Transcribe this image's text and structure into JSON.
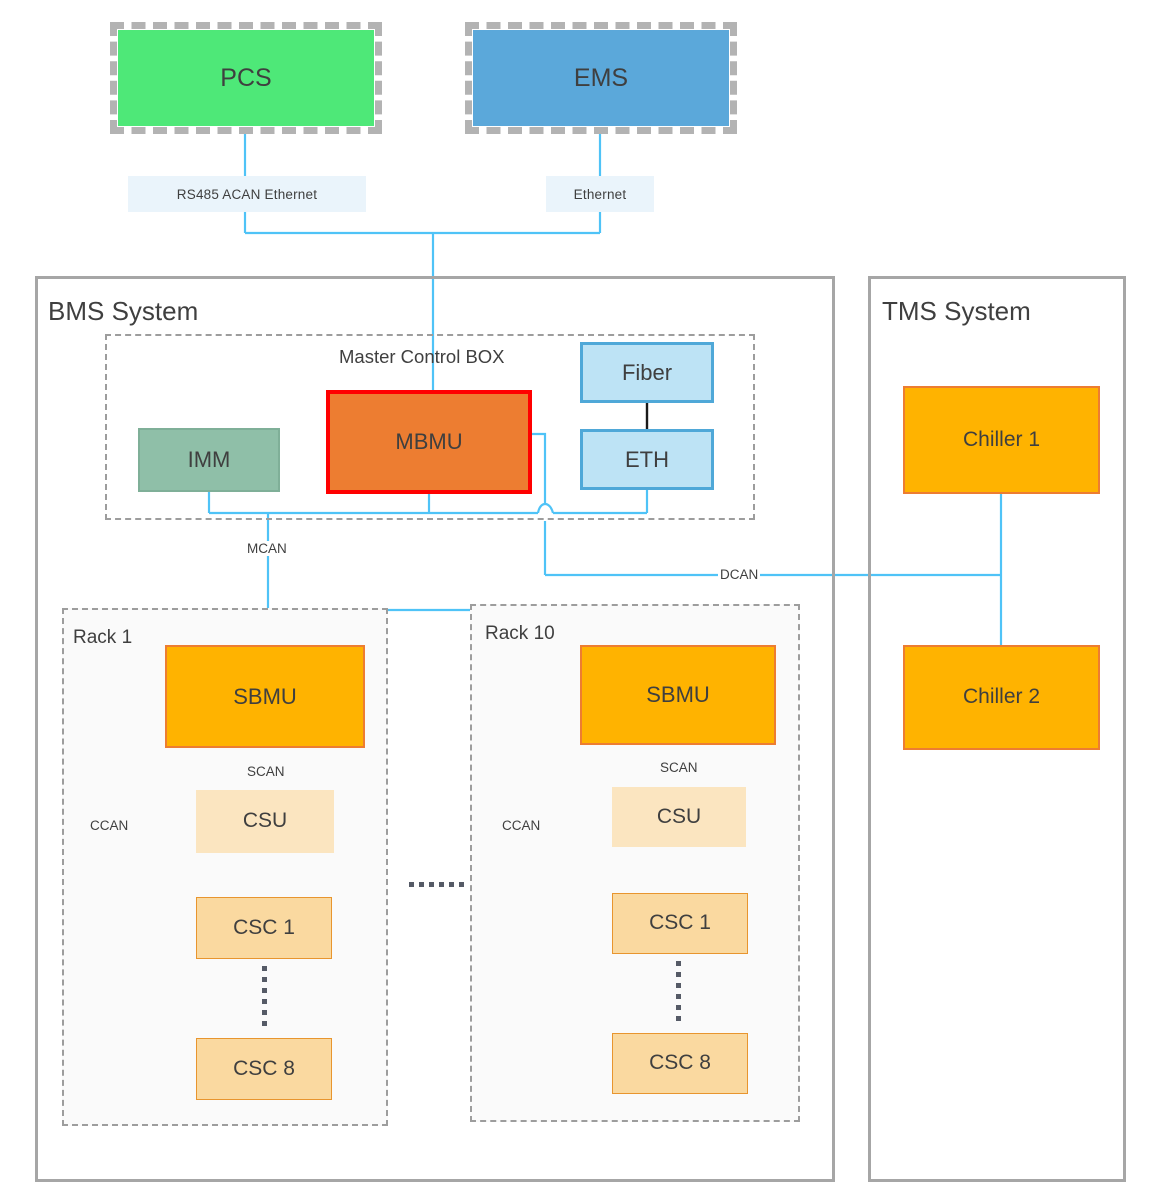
{
  "diagram": {
    "external_systems": [
      {
        "id": "pcs",
        "label": "PCS",
        "color": "#4EE878"
      },
      {
        "id": "ems",
        "label": "EMS",
        "color": "#5BA8DA"
      }
    ],
    "protocol_chips": [
      {
        "id": "pcs-protocols",
        "label": "RS485  ACAN   Ethernet"
      },
      {
        "id": "ems-protocols",
        "label": "Ethernet"
      }
    ],
    "panels": [
      {
        "id": "bms",
        "title": "BMS System"
      },
      {
        "id": "tms",
        "title": "TMS System"
      }
    ],
    "master_control_box": {
      "title": "Master Control BOX",
      "nodes": [
        {
          "id": "imm",
          "label": "IMM",
          "color": "#8FBFA8"
        },
        {
          "id": "mbmu",
          "label": "MBMU",
          "color": "#ED7D31",
          "border": "#FF0000"
        },
        {
          "id": "fiber",
          "label": "Fiber",
          "color": "#BDE3F5"
        },
        {
          "id": "eth",
          "label": "ETH",
          "color": "#BDE3F5"
        }
      ]
    },
    "buses": [
      {
        "id": "mcan",
        "label": "MCAN"
      },
      {
        "id": "dcan",
        "label": "DCAN"
      }
    ],
    "racks": [
      {
        "id": "rack-1",
        "title": "Rack 1",
        "sbmu": "SBMU",
        "scan_label": "SCAN",
        "ccan_label": "CCAN",
        "csu": "CSU",
        "csc_first": "CSC 1",
        "csc_last": "CSC 8"
      },
      {
        "id": "rack-10",
        "title": "Rack 10",
        "sbmu": "SBMU",
        "scan_label": "SCAN",
        "ccan_label": "CCAN",
        "csu": "CSU",
        "csc_first": "CSC 1",
        "csc_last": "CSC 8"
      }
    ],
    "tms_nodes": [
      {
        "id": "chiller-1",
        "label": "Chiller 1",
        "color": "#FFB300"
      },
      {
        "id": "chiller-2",
        "label": "Chiller 2",
        "color": "#FFB300"
      }
    ],
    "colors": {
      "wire": "#4FC3F7",
      "fiber_link": "#1a1a1a",
      "panel_border": "#a6a6a6",
      "group_border": "#9d9d9d",
      "text": "#3f3f3f"
    }
  }
}
